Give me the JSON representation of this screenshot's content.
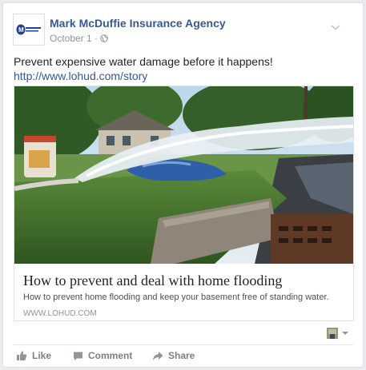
{
  "post": {
    "page_name": "Mark McDuffie Insurance Agency",
    "date": "October 1",
    "separator": "·",
    "logo_text": "Mark McDuffie",
    "message": "Prevent expensive water damage before it happens!",
    "url": "http://www.lohud.com/story"
  },
  "link_preview": {
    "title": "How to prevent and deal with home flooding",
    "description": "How to prevent home flooding and keep your basement free of standing water.",
    "domain": "WWW.LOHUD.COM"
  },
  "actions": {
    "like": "Like",
    "comment": "Comment",
    "share": "Share"
  },
  "icons": {
    "privacy": "globe-icon",
    "options": "chevron-down-icon",
    "audience": "avatar-dropdown"
  },
  "colors": {
    "link": "#365899",
    "text": "#1d2129",
    "muted": "#90949c",
    "action": "#7f7f7f"
  }
}
